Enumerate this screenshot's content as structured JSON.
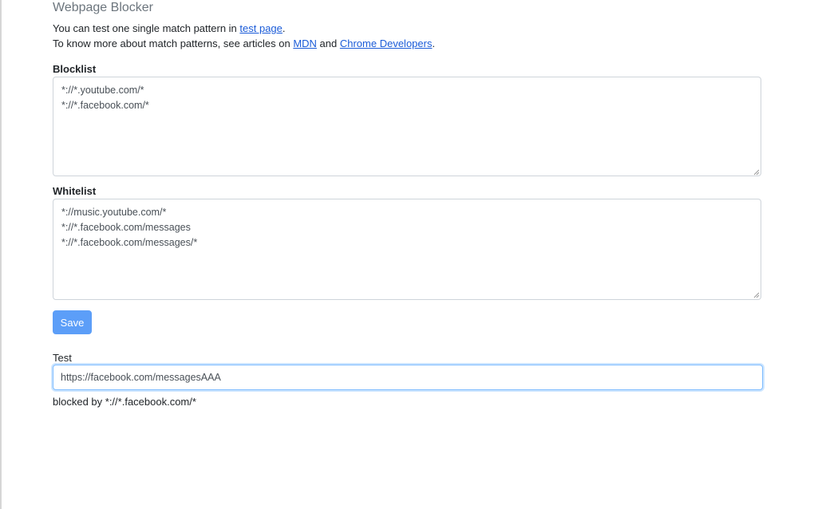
{
  "app": {
    "title": "Webpage Blocker"
  },
  "intro": {
    "line1_prefix": "You can test one single match pattern in ",
    "line1_link": "test page",
    "line1_suffix": ".",
    "line2_prefix": "To know more about match patterns, see articles on ",
    "line2_link1": "MDN",
    "line2_middle": " and ",
    "line2_link2": "Chrome Developers",
    "line2_suffix": "."
  },
  "blocklist": {
    "label": "Blocklist",
    "value": "*://*.youtube.com/*\n*://*.facebook.com/*"
  },
  "whitelist": {
    "label": "Whitelist",
    "value": "*://music.youtube.com/*\n*://*.facebook.com/messages\n*://*.facebook.com/messages/*"
  },
  "save": {
    "label": "Save"
  },
  "test": {
    "label": "Test",
    "value": "https://facebook.com/messagesAAA",
    "result": "blocked by *://*.facebook.com/*"
  },
  "colors": {
    "primary": "#5c9ef8",
    "link": "#1a5bd8",
    "focus": "#80bdff"
  }
}
